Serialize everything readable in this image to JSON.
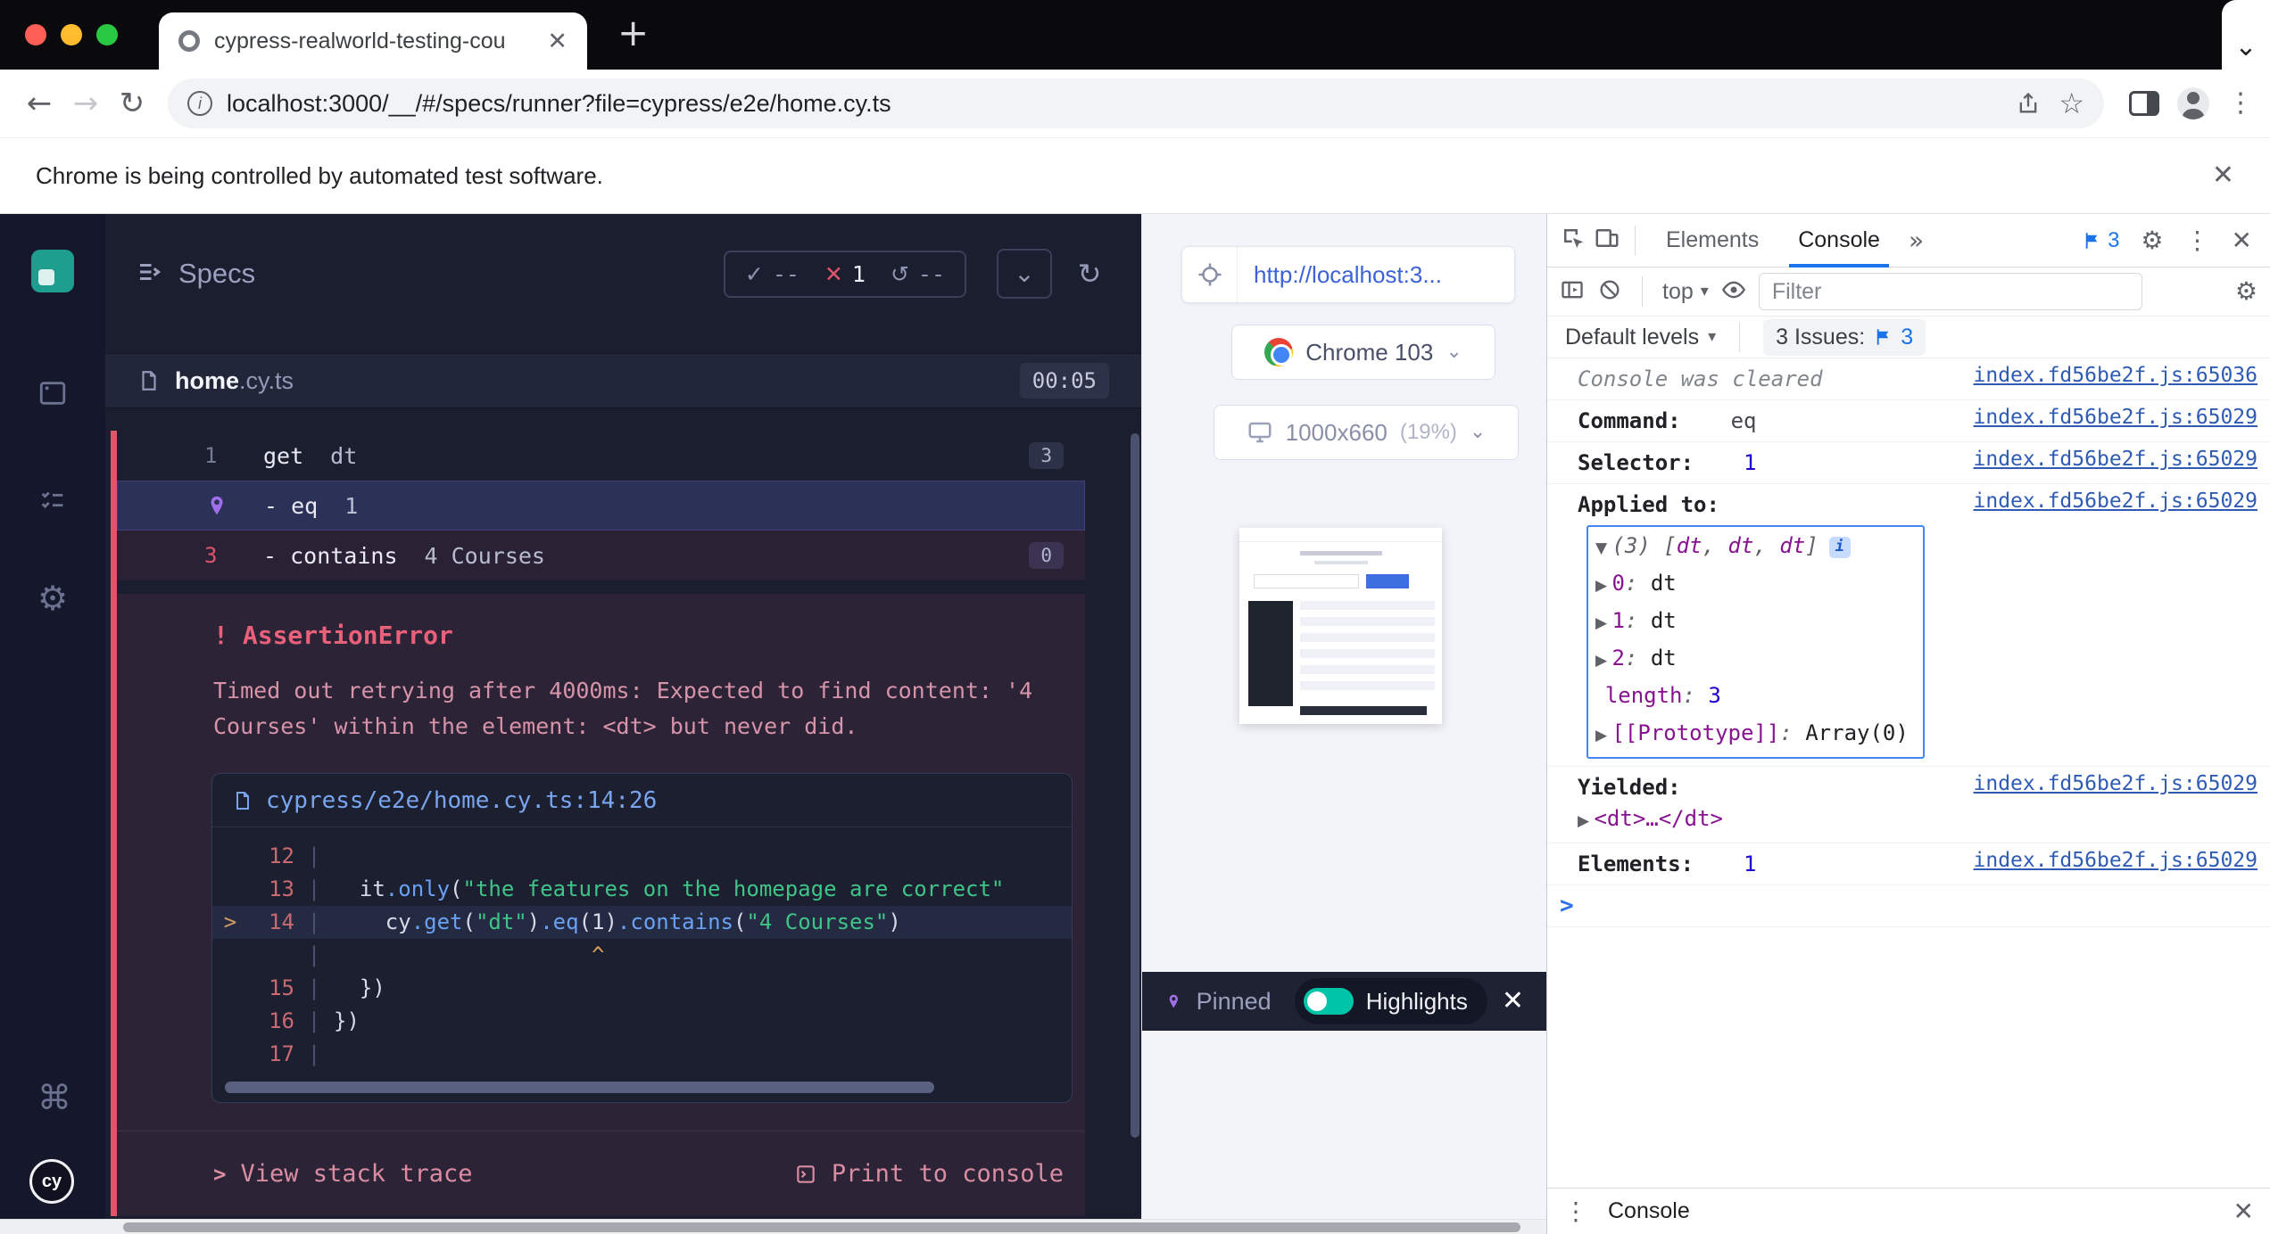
{
  "icons": {
    "check": "✓",
    "cross": "✕",
    "retry": "↺",
    "chevron": "⌄",
    "refresh": "↻",
    "close": "✕",
    "kebab": "⋮",
    "gear": "⚙",
    "back": "←",
    "forward": "→",
    "star": "☆",
    "plus": "+",
    "more_tabs": "»",
    "caret": "▾",
    "command": "⌘",
    "info": "i",
    "cy_badge": "cy"
  },
  "browser": {
    "tab_title": "cypress-realworld-testing-cou",
    "url": "localhost:3000/__/#/specs/runner?file=cypress/e2e/home.cy.ts",
    "infobar": "Chrome is being controlled by automated test software."
  },
  "reporter": {
    "title": "Specs",
    "stats": {
      "passed": "--",
      "failed": "1",
      "pending": "--"
    },
    "spec": {
      "name": "home",
      "ext": ".cy.ts",
      "time": "00:05"
    },
    "commands": [
      {
        "num": "1",
        "method": "get",
        "args": "dt",
        "badge": "3",
        "state": "normal",
        "pin": false
      },
      {
        "num": "",
        "method": "- eq",
        "args": "1",
        "badge": "",
        "state": "pinned",
        "pin": true
      },
      {
        "num": "3",
        "method": "- contains",
        "args": "4 Courses",
        "badge": "0",
        "state": "failed",
        "pin": false
      }
    ],
    "error": {
      "bang": "!",
      "name": "AssertionError",
      "message": "Timed out retrying after 4000ms: Expected to find content: '4 Courses' within the element: <dt> but never did.",
      "frame_link": "cypress/e2e/home.cy.ts:14:26",
      "code_lines": [
        {
          "marker": "",
          "num": "12",
          "tokens": []
        },
        {
          "marker": "",
          "num": "13",
          "tokens": [
            [
              "p",
              "  it"
            ],
            [
              "m",
              ".only"
            ],
            [
              "p",
              "("
            ],
            [
              "s",
              "\"the features on the homepage are correct\""
            ]
          ]
        },
        {
          "marker": ">",
          "num": "14",
          "hl": true,
          "tokens": [
            [
              "p",
              "    cy"
            ],
            [
              "m",
              ".get"
            ],
            [
              "p",
              "("
            ],
            [
              "s",
              "\"dt\""
            ],
            [
              "p",
              ")"
            ],
            [
              "m",
              ".eq"
            ],
            [
              "p",
              "("
            ],
            [
              "p",
              "1"
            ],
            [
              "p",
              ")"
            ],
            [
              "m",
              ".contains"
            ],
            [
              "p",
              "("
            ],
            [
              "s",
              "\"4 Courses\""
            ],
            [
              "p",
              ")"
            ]
          ]
        },
        {
          "marker": "",
          "num": "",
          "tokens": [
            [
              "c",
              "                    ^"
            ]
          ]
        },
        {
          "marker": "",
          "num": "15",
          "tokens": [
            [
              "p",
              "  })"
            ]
          ]
        },
        {
          "marker": "",
          "num": "16",
          "tokens": [
            [
              "p",
              "})"
            ]
          ]
        },
        {
          "marker": "",
          "num": "17",
          "tokens": []
        }
      ],
      "view_stack": "View stack trace",
      "print_console": "Print to console"
    }
  },
  "aut": {
    "url": "http://localhost:3...",
    "browser": "Chrome 103",
    "viewport": "1000x660",
    "zoom": "(19%)",
    "pinned": "Pinned",
    "highlights": "Highlights"
  },
  "devtools": {
    "tabs": {
      "elements": "Elements",
      "console": "Console"
    },
    "msg_count": "3",
    "context": "top",
    "filter_placeholder": "Filter",
    "levels": "Default levels",
    "issues_label": "3 Issues:",
    "issues_count": "3",
    "drawer": "Console",
    "console_rows": [
      {
        "type": "info",
        "text": "Console was cleared",
        "link": "index.fd56be2f.js:65036"
      },
      {
        "type": "kv",
        "label": "Command:",
        "value": "eq",
        "vclass": "plain",
        "link": "index.fd56be2f.js:65029"
      },
      {
        "type": "kv",
        "label": "Selector:",
        "value": "1",
        "vclass": "num",
        "link": "index.fd56be2f.js:65029"
      },
      {
        "type": "tree",
        "label": "Applied to:",
        "link": "index.fd56be2f.js:65029",
        "preview_count": "(3) ",
        "preview_tags": [
          "dt",
          "dt",
          "dt"
        ],
        "children": [
          {
            "caret": true,
            "key": "0",
            "value": "dt",
            "vclass": "plain"
          },
          {
            "caret": true,
            "key": "1",
            "value": "dt",
            "vclass": "plain"
          },
          {
            "caret": true,
            "key": "2",
            "value": "dt",
            "vclass": "plain"
          },
          {
            "caret": false,
            "key": "length",
            "value": "3",
            "vclass": "num"
          },
          {
            "caret": true,
            "key": "[[Prototype]]",
            "value": "Array(0)",
            "vclass": "plain"
          }
        ]
      },
      {
        "type": "element",
        "label": "Yielded:",
        "value": "<dt>…</dt>",
        "link": "index.fd56be2f.js:65029"
      },
      {
        "type": "kv",
        "label": "Elements:",
        "value": "1",
        "vclass": "num",
        "link": "index.fd56be2f.js:65029"
      },
      {
        "type": "prompt"
      }
    ]
  }
}
